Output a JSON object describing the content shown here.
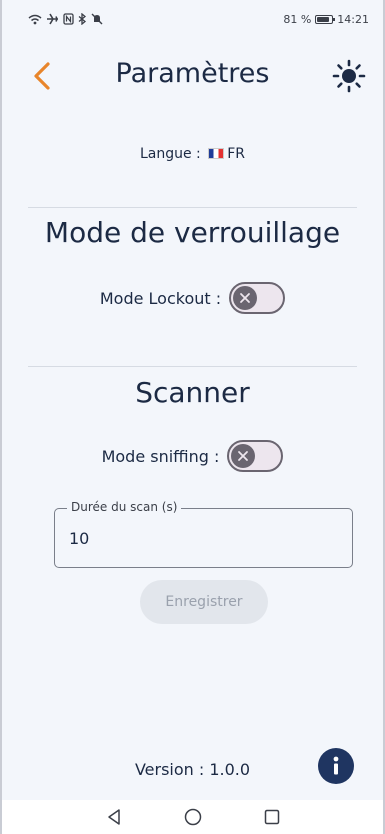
{
  "status_bar": {
    "battery_text": "81 %",
    "battery_level": 0.81,
    "time": "14:21",
    "icons": [
      "wifi-icon",
      "airplane-icon",
      "nfc-icon",
      "bluetooth-icon",
      "mute-icon"
    ]
  },
  "header": {
    "title": "Paramètres",
    "back_icon": "chevron-left-icon",
    "theme_icon": "sun-icon",
    "accent_color": "#e8852b"
  },
  "language": {
    "label": "Langue :",
    "flag": "flag-fr-icon",
    "code": "FR"
  },
  "lock_section": {
    "title": "Mode de verrouillage",
    "toggle_label": "Mode Lockout :",
    "toggle_on": false
  },
  "scanner_section": {
    "title": "Scanner",
    "toggle_label": "Mode sniffing :",
    "toggle_on": false,
    "duration_label": "Durée du scan (s)",
    "duration_value": "10",
    "save_label": "Enregistrer"
  },
  "footer": {
    "version": "Version : 1.0.0",
    "info_icon": "info-icon"
  },
  "nav_bar": {
    "icons": [
      "back-triangle-icon",
      "home-circle-icon",
      "recents-square-icon"
    ]
  }
}
